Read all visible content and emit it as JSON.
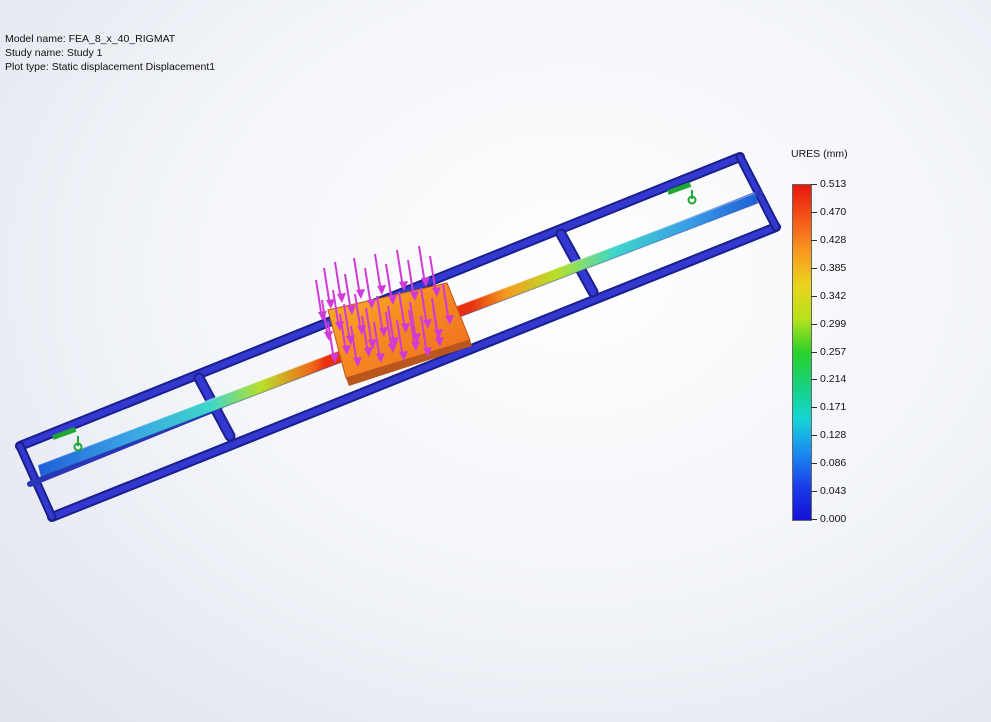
{
  "info": {
    "model_name": "Model name: FEA_8_x_40_RIGMAT",
    "study_name": "Study name: Study 1",
    "plot_type": "Plot type: Static displacement Displacement1"
  },
  "legend": {
    "title": "URES (mm)",
    "values": [
      "0.513",
      "0.470",
      "0.428",
      "0.385",
      "0.342",
      "0.299",
      "0.257",
      "0.214",
      "0.171",
      "0.128",
      "0.086",
      "0.043",
      "0.000"
    ]
  },
  "colors": {
    "frame": "#2b32c4",
    "load_arrow": "#d13ad6",
    "fixture": "#1fa834",
    "high": "#e8160c",
    "low": "#1410d6"
  },
  "icons": {
    "load": "down-arrow-icon",
    "fixture": "fixed-support-icon"
  }
}
